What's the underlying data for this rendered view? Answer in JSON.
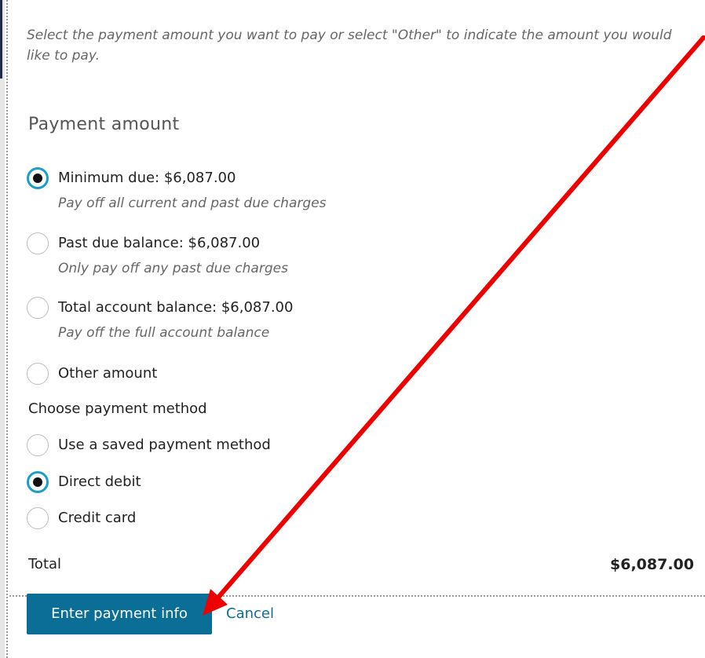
{
  "instructions": "Select the payment amount you want to pay or select \"Other\" to indicate the amount you would like to pay.",
  "payment_amount": {
    "title": "Payment amount",
    "options": [
      {
        "label": "Minimum due: $6,087.00",
        "sublabel": "Pay off all current and past due charges",
        "selected": true
      },
      {
        "label": "Past due balance: $6,087.00",
        "sublabel": "Only pay off any past due charges",
        "selected": false
      },
      {
        "label": "Total account balance: $6,087.00",
        "sublabel": "Pay off the full account balance",
        "selected": false
      },
      {
        "label": "Other amount",
        "selected": false
      }
    ]
  },
  "payment_method": {
    "title": "Choose payment method",
    "options": [
      {
        "label": "Use a saved payment method",
        "selected": false
      },
      {
        "label": "Direct debit",
        "selected": true
      },
      {
        "label": "Credit card",
        "selected": false
      }
    ]
  },
  "total": {
    "label": "Total",
    "value": "$6,087.00"
  },
  "actions": {
    "primary_label": "Enter payment info",
    "cancel_label": "Cancel"
  },
  "colors": {
    "accent": "#0b6e97",
    "radio_selected_ring": "#1b9ec9",
    "annotation_arrow": "#ee0000"
  }
}
